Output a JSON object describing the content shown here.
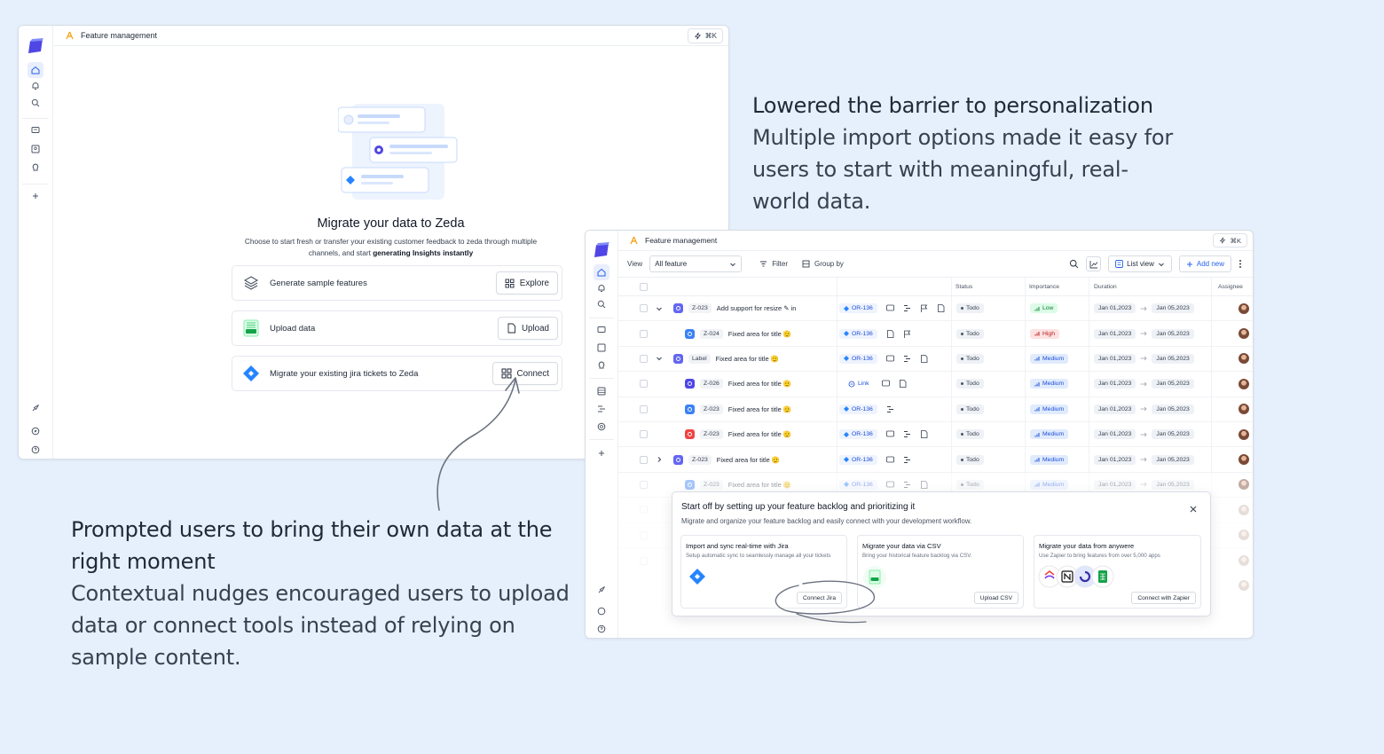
{
  "callouts": {
    "top": {
      "heading": "Lowered the barrier to personalization",
      "body": "Multiple import options made it easy for users to start with meaningful, real-world data."
    },
    "bottom": {
      "heading": "Prompted users to bring their own data at the right moment",
      "body": "Contextual nudges encouraged users to upload data or connect tools instead of relying on sample content."
    }
  },
  "window1": {
    "breadcrumb": "Feature management",
    "shortcut": "⌘K",
    "title": "Migrate your data to Zeda",
    "subtitle_line1": "Choose to start fresh or transfer your existing customer feedback to zeda through multiple",
    "subtitle_line2_prefix": "channels, and start ",
    "subtitle_line2_bold": "generating Insights instantly",
    "options": [
      {
        "label": "Generate sample features",
        "button": "Explore",
        "icon": "layers-icon"
      },
      {
        "label": "Upload data",
        "button": "Upload",
        "icon": "csv-file-icon"
      },
      {
        "label": "Migrate your existing jira tickets to Zeda",
        "button": "Connect",
        "icon": "jira-icon"
      }
    ]
  },
  "window2": {
    "breadcrumb": "Feature management",
    "shortcut": "⌘K",
    "toolbar": {
      "view_label": "View",
      "view_value": "All feature",
      "filter": "Filter",
      "group_by": "Group by",
      "list_view": "List view",
      "add_new": "Add new"
    },
    "columns": {
      "status": "Status",
      "importance": "Importance",
      "duration": "Duration",
      "assignee": "Assignee"
    },
    "rows": [
      {
        "expand": "down",
        "icon_color": "#6366f1",
        "id": "Z-023",
        "title": "Add support for resize ✎ in",
        "ref": "OR-136",
        "status": "Todo",
        "importance": "Low",
        "start": "Jan 01,2023",
        "end": "Jan 05,2023",
        "icons": 5,
        "faded": 0
      },
      {
        "expand": "",
        "icon_color": "#3b82f6",
        "id": "Z-024",
        "title": "Fixed area for title 🫡",
        "ref": "OR-136",
        "status": "Todo",
        "importance": "High",
        "start": "Jan 01,2023",
        "end": "Jan 05,2023",
        "icons": 2,
        "faded": 0
      },
      {
        "expand": "down",
        "icon_color": "#6366f1",
        "id": "Label",
        "title": "Fixed area for title 🫡",
        "ref": "OR-136",
        "status": "Todo",
        "importance": "Medium",
        "start": "Jan 01,2023",
        "end": "Jan 05,2023",
        "icons": 3,
        "faded": 0
      },
      {
        "expand": "",
        "icon_color": "#4f46e5",
        "id": "Z-026",
        "title": "Fixed area for title 🫡",
        "ref": "Link",
        "status": "Todo",
        "importance": "Medium",
        "start": "Jan 01,2023",
        "end": "Jan 05,2023",
        "icons": 2,
        "faded": 0
      },
      {
        "expand": "",
        "icon_color": "#3b82f6",
        "id": "Z-023",
        "title": "Fixed area for title 🫡",
        "ref": "OR-136",
        "status": "Todo",
        "importance": "Medium",
        "start": "Jan 01,2023",
        "end": "Jan 05,2023",
        "icons": 1,
        "faded": 0
      },
      {
        "expand": "",
        "icon_color": "#ef4444",
        "id": "Z-023",
        "title": "Fixed area for title 🫡",
        "ref": "OR-136",
        "status": "Todo",
        "importance": "Medium",
        "start": "Jan 01,2023",
        "end": "Jan 05,2023",
        "icons": 3,
        "faded": 0
      },
      {
        "expand": "right",
        "icon_color": "#6366f1",
        "id": "Z-023",
        "title": "Fixed area for title 🫡",
        "ref": "OR-136",
        "status": "Todo",
        "importance": "Medium",
        "start": "Jan 01,2023",
        "end": "Jan 05,2023",
        "icons": 2,
        "faded": 0
      },
      {
        "expand": "",
        "icon_color": "#3b82f6",
        "id": "Z-023",
        "title": "Fixed area for title 🫡",
        "ref": "OR-136",
        "status": "Todo",
        "importance": "Medium",
        "start": "Jan 01,2023",
        "end": "Jan 05,2023",
        "icons": 3,
        "faded": 1
      }
    ],
    "onboarding": {
      "title": "Start off by setting up your feature backlog and prioritizing it",
      "subtitle": "Migrate and organize your feature backlog and easily connect with your development workflow.",
      "cards": [
        {
          "title": "Import and sync real-time with Jira",
          "desc": "Setup automatic sync to seamlessly manage all your tickets",
          "button": "Connect Jira"
        },
        {
          "title": "Migrate your data via CSV",
          "desc": "Bring your historical feature backlog via CSV.",
          "button": "Upload CSV"
        },
        {
          "title": "Migrate your data from anywere",
          "desc": "Use Zapier to bring features from over 5,000 apps",
          "button": "Connect with Zapier"
        }
      ]
    }
  },
  "colors": {
    "background": "#e6f0fc",
    "brand": "#4f46e5",
    "jira": "#2684ff",
    "csv": "#16a34a"
  }
}
